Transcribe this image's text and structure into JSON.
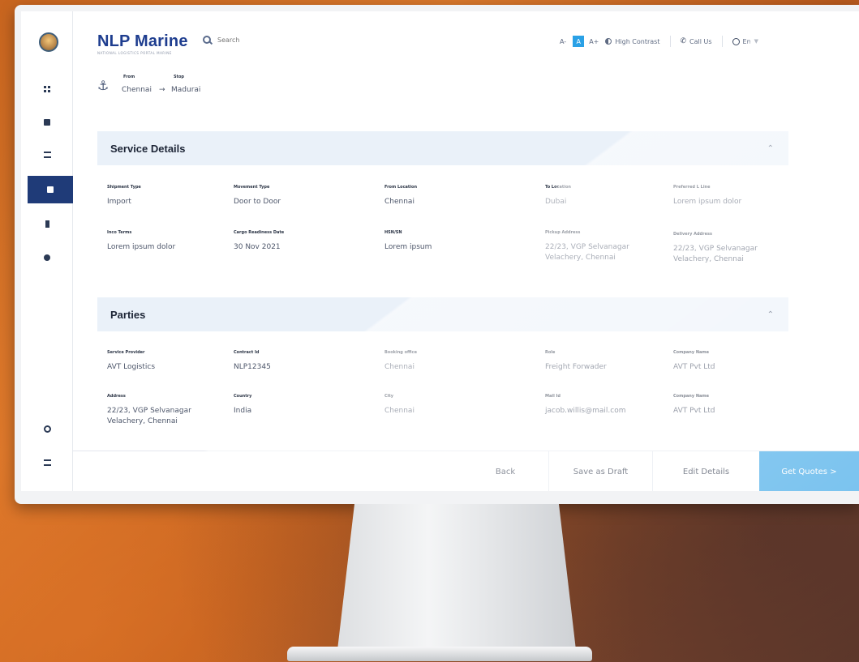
{
  "app": {
    "brand_name": "NLP Marine",
    "brand_tagline": "NATIONAL LOGISTICS PORTAL MARINE"
  },
  "header": {
    "search_placeholder": "Search",
    "font_decrease": "A-",
    "font_badge": "A",
    "font_increase": "A+",
    "high_contrast": "High Contrast",
    "call_us": "Call Us",
    "language": "En"
  },
  "route": {
    "from_label": "From",
    "from_value": "Chennai",
    "arrow": "→",
    "stop_label": "Stop",
    "stop_value": "Madurai"
  },
  "service_details": {
    "title": "Service Details",
    "fields": [
      {
        "label": "Shipment Type",
        "value": "Import"
      },
      {
        "label": "Movement Type",
        "value": "Door to Door"
      },
      {
        "label": "From Location",
        "value": "Chennai"
      },
      {
        "label": "To Location",
        "value": "Dubai"
      },
      {
        "label": "Preferred L Line",
        "value": "Lorem ipsum dolor"
      },
      {
        "label": "Inco Terms",
        "value": "Lorem ipsum dolor"
      },
      {
        "label": "Cargo Readiness Date",
        "value": "30 Nov 2021"
      },
      {
        "label": "HSN/SN",
        "value": "Lorem ipsum"
      },
      {
        "label": "Pickup Address",
        "value_line1": "22/23, VGP Selvanagar",
        "value_line2": "Velachery, Chennai"
      },
      {
        "label": "Delivery Address",
        "value_line1": "22/23, VGP Selvanagar",
        "value_line2": "Velachery, Chennai"
      }
    ]
  },
  "parties": {
    "title": "Parties",
    "fields": [
      {
        "label": "Service Provider",
        "value": "AVT Logistics"
      },
      {
        "label": "Contract Id",
        "value": "NLP12345"
      },
      {
        "label": "Booking office",
        "value": "Chennai"
      },
      {
        "label": "Role",
        "value": "Freight Forwader"
      },
      {
        "label": "Company Name",
        "value": "AVT Pvt Ltd"
      },
      {
        "label": "Address",
        "value_line1": "22/23, VGP Selvanagar",
        "value_line2": "Velachery, Chennai"
      },
      {
        "label": "Country",
        "value": "India"
      },
      {
        "label": "City",
        "value": "Chennai"
      },
      {
        "label": "Mail Id",
        "value": "jacob.willis@mail.com"
      },
      {
        "label": "Company Name",
        "value": "AVT Pvt Ltd"
      }
    ]
  },
  "footer": {
    "back": "Back",
    "save_draft": "Save as Draft",
    "edit_details": "Edit Details",
    "get_quotes": "Get Quotes >"
  },
  "colors": {
    "brand": "#1e3d8f",
    "sidebar_active": "#1f3b78",
    "primary_button": "#34a3e6",
    "section_header": "#eaf1f9"
  },
  "icons": {
    "sidebar": [
      "dashboard-icon",
      "box-icon",
      "list-icon",
      "briefcase-icon",
      "bookmark-icon",
      "chat-icon",
      "settings-icon",
      "menu-icon"
    ]
  }
}
